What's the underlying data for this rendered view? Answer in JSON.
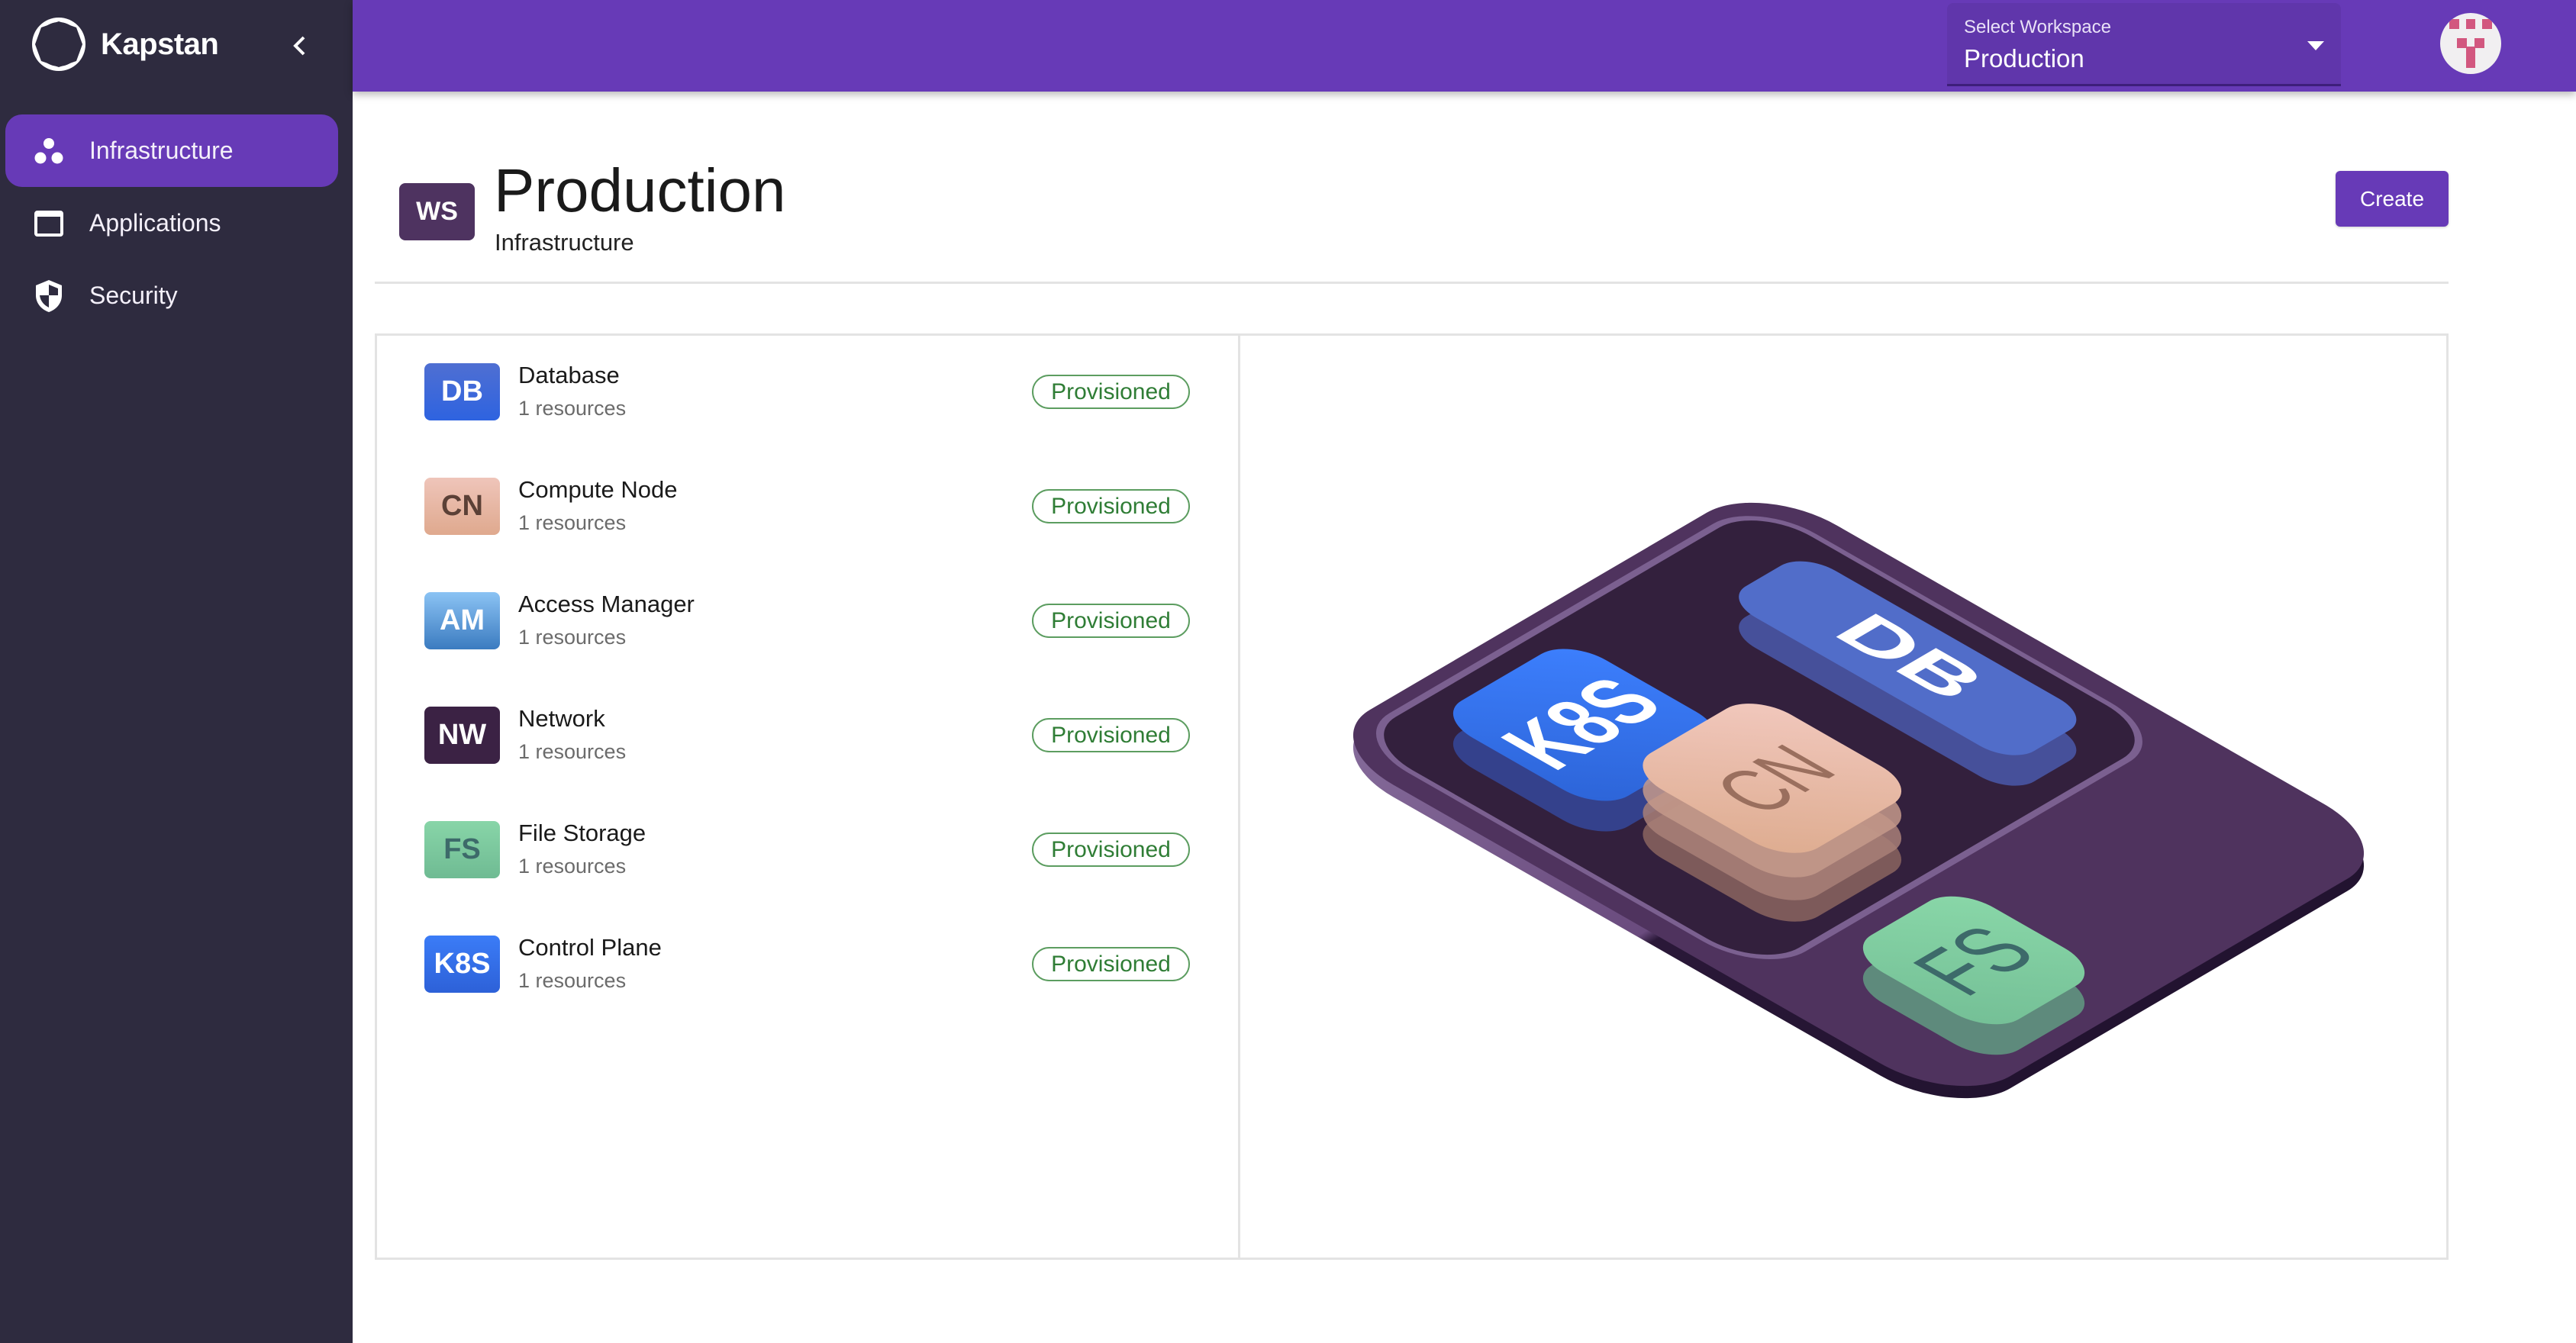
{
  "sidebar": {
    "brand": "Kapstan",
    "collapse_icon": "chevron-left-icon",
    "items": [
      {
        "label": "Infrastructure",
        "icon": "three-dots-cluster-icon",
        "active": true
      },
      {
        "label": "Applications",
        "icon": "window-icon",
        "active": false
      },
      {
        "label": "Security",
        "icon": "shield-icon",
        "active": false
      }
    ]
  },
  "topbar": {
    "workspace_select": {
      "label": "Select Workspace",
      "value": "Production"
    },
    "avatar_icon": "identicon-avatar"
  },
  "header": {
    "badge": "WS",
    "title": "Production",
    "subtitle": "Infrastructure",
    "create_label": "Create"
  },
  "resources": [
    {
      "abbr": "DB",
      "name": "Database",
      "count": "1 resources",
      "status": "Provisioned",
      "color": "#3b67dc",
      "text_color": "#ffffff"
    },
    {
      "abbr": "CN",
      "name": "Compute Node",
      "count": "1 resources",
      "status": "Provisioned",
      "color": "#e7b6a3",
      "text_color": "#5b4036"
    },
    {
      "abbr": "AM",
      "name": "Access Manager",
      "count": "1 resources",
      "status": "Provisioned",
      "color": "#5a98d8",
      "text_color": "#ffffff"
    },
    {
      "abbr": "NW",
      "name": "Network",
      "count": "1 resources",
      "status": "Provisioned",
      "color": "#3b2244",
      "text_color": "#ffffff"
    },
    {
      "abbr": "FS",
      "name": "File Storage",
      "count": "1 resources",
      "status": "Provisioned",
      "color": "#7cc79b",
      "text_color": "#3d6a6a"
    },
    {
      "abbr": "K8S",
      "name": "Control Plane",
      "count": "1 resources",
      "status": "Provisioned",
      "color": "#3a74ec",
      "text_color": "#ffffff"
    }
  ],
  "illustration": {
    "keys": [
      {
        "label": "DB",
        "color": "#516dc9",
        "text_color": "#ffffff"
      },
      {
        "label": "K8S",
        "color": "#3474ee",
        "text_color": "#ffffff"
      },
      {
        "label": "CN",
        "color": "#e8bba8",
        "text_color": "#9a6f5e"
      },
      {
        "label": "FS",
        "color": "#80cfa1",
        "text_color": "#3d6a6a"
      }
    ]
  },
  "colors": {
    "accent": "#673ab7",
    "sidebar_bg": "#2e2b3f",
    "provisioned": "#2f7d35"
  }
}
